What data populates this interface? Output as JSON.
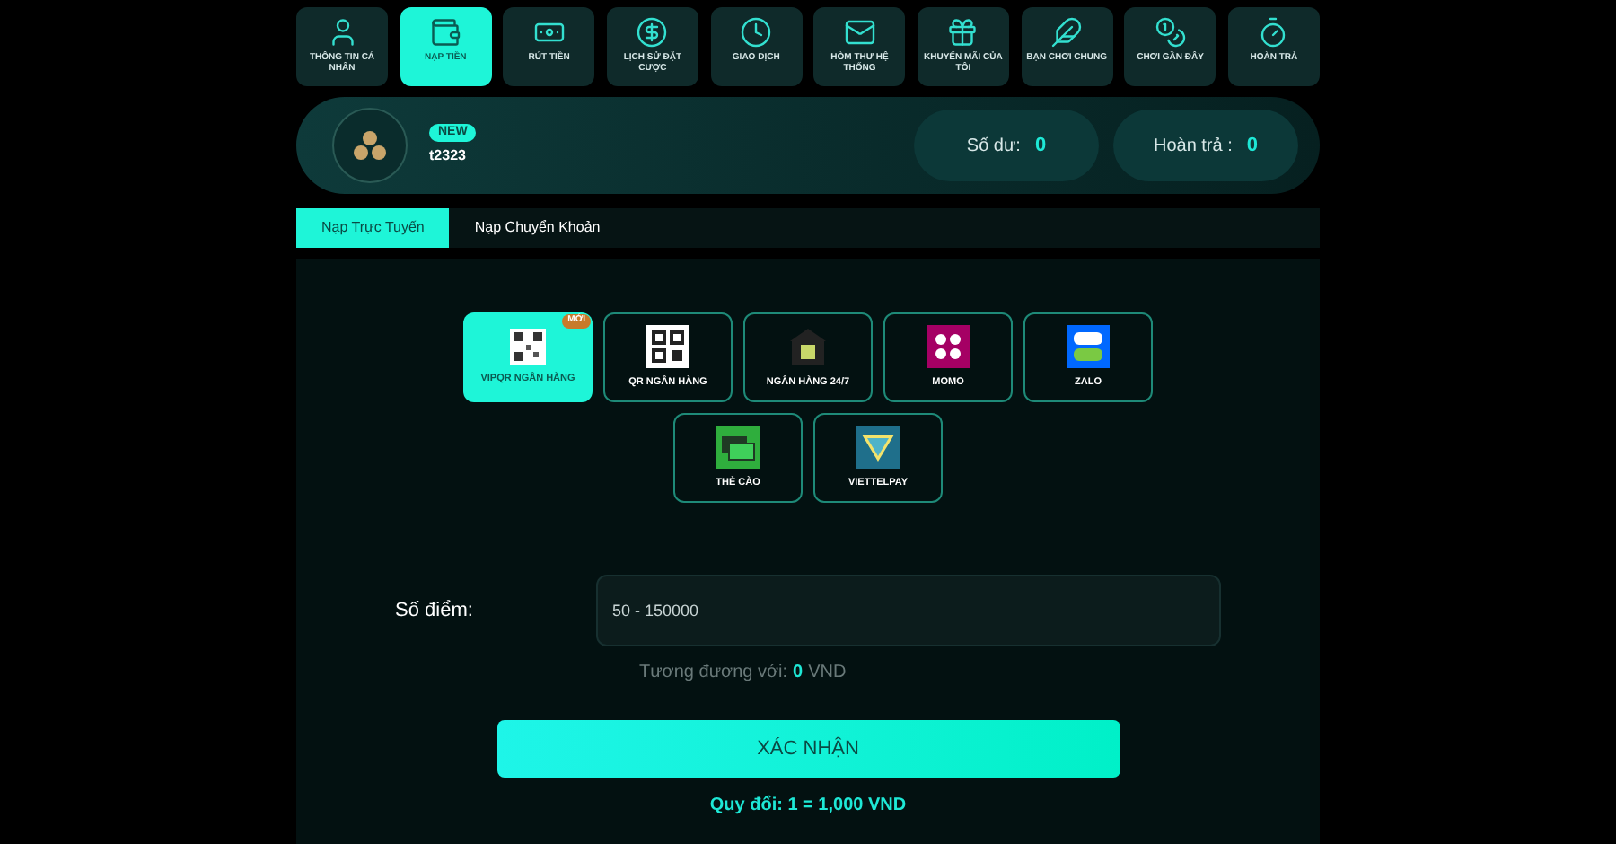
{
  "nav": [
    {
      "label": "THÔNG TIN CÁ NHÂN",
      "kind": "user",
      "selected": false
    },
    {
      "label": "NẠP TIỀN",
      "kind": "wallet",
      "selected": true
    },
    {
      "label": "RÚT TIỀN",
      "kind": "atm",
      "selected": false
    },
    {
      "label": "LỊCH SỬ ĐẶT CƯỢC",
      "kind": "history",
      "selected": false
    },
    {
      "label": "GIAO DỊCH",
      "kind": "clock",
      "selected": false
    },
    {
      "label": "HÒM THƯ HỆ THỐNG",
      "kind": "mail",
      "selected": false
    },
    {
      "label": "KHUYẾN MÃI CỦA TÔI",
      "kind": "gift",
      "selected": false
    },
    {
      "label": "BẠN CHƠI CHUNG",
      "kind": "feather",
      "selected": false
    },
    {
      "label": "CHƠI GẦN ĐÂY",
      "kind": "coin",
      "selected": false
    },
    {
      "label": "HOÀN TRẢ",
      "kind": "timer",
      "selected": false
    }
  ],
  "profile": {
    "badge": "NEW",
    "username": "t2323",
    "stats": [
      {
        "label": "Số dư:",
        "value": "0"
      },
      {
        "label": "Hoàn trả :",
        "value": "0"
      }
    ]
  },
  "tabs": [
    {
      "label": "Nạp Trực Tuyến",
      "selected": true
    },
    {
      "label": "Nạp Chuyển Khoản",
      "selected": false
    }
  ],
  "methods": [
    {
      "label": "VIPQR NGÂN HÀNG",
      "kind": "vipqr",
      "selected": true,
      "ribbon": "MỚI"
    },
    {
      "label": "QR NGÂN HÀNG",
      "kind": "qr",
      "selected": false
    },
    {
      "label": "NGÂN HÀNG 24/7",
      "kind": "bank",
      "selected": false
    },
    {
      "label": "MOMO",
      "kind": "momo",
      "selected": false
    },
    {
      "label": "ZALO",
      "kind": "zalo",
      "selected": false
    },
    {
      "label": "THẺ CÀO",
      "kind": "card",
      "selected": false
    },
    {
      "label": "VIETTELPAY",
      "kind": "viettel",
      "selected": false
    }
  ],
  "form": {
    "label": "Số điểm:",
    "placeholder": "50 - 150000",
    "equivalent_prefix": "Tương đương với:",
    "equivalent_value": "0",
    "equivalent_suffix": "VND",
    "submit": "XÁC NHẬN",
    "rate": "Quy đổi: 1 = 1,000 VND"
  }
}
